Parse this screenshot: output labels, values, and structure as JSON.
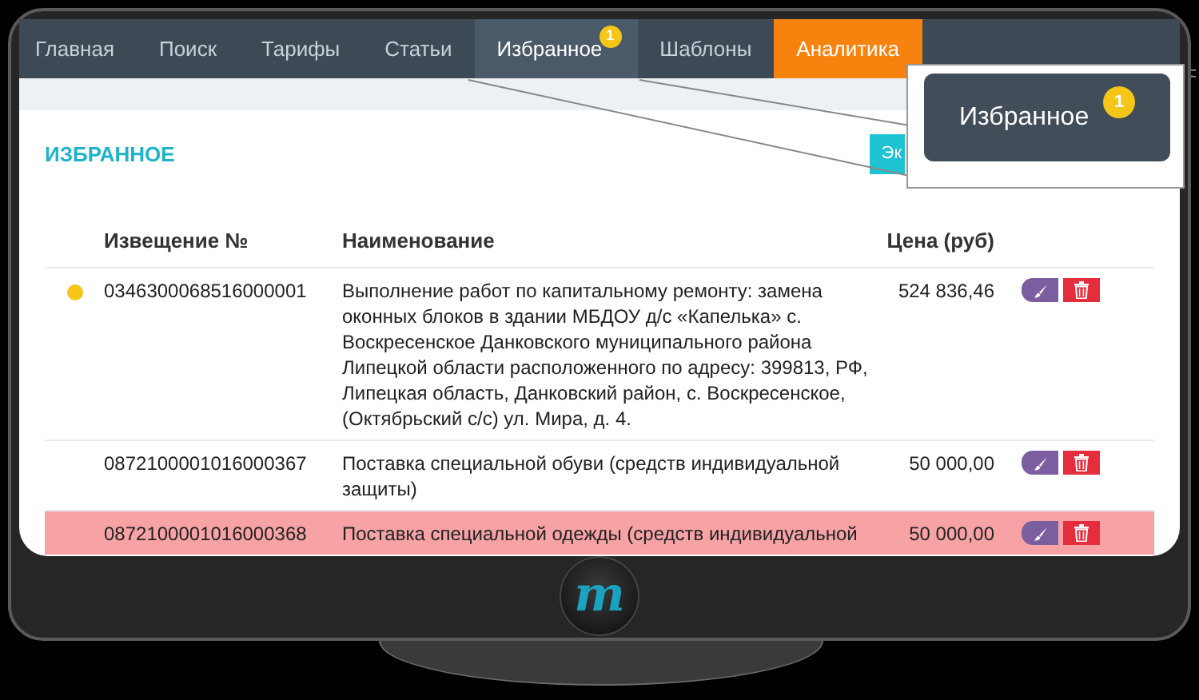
{
  "nav": {
    "tabs": [
      {
        "label": "Главная",
        "selected": false,
        "kind": "plain"
      },
      {
        "label": "Поиск",
        "selected": false,
        "kind": "plain"
      },
      {
        "label": "Тарифы",
        "selected": false,
        "kind": "plain"
      },
      {
        "label": "Статьи",
        "selected": false,
        "kind": "plain"
      },
      {
        "label": "Избранное",
        "selected": true,
        "kind": "plain",
        "badge": "1"
      },
      {
        "label": "Шаблоны",
        "selected": false,
        "kind": "plain"
      },
      {
        "label": "Аналитика",
        "selected": false,
        "kind": "highlight"
      }
    ]
  },
  "page": {
    "title": "ИЗБРАННОЕ",
    "button": "Эк"
  },
  "table": {
    "columns": [
      "Извещение №",
      "Наименование",
      "Цена (руб)"
    ],
    "rows": [
      {
        "number": "0346300068516000001",
        "name": "Выполнение работ по капитальному ремонту: замена оконных блоков в здании МБДОУ д/с «Капелька» с. Воскресенское Данковского муниципального района Липецкой области расположенного по адресу: 399813, РФ, Липецкая область, Данковский район, с. Воскресенское, (Октябрьский с/с) ул. Мира, д. 4.",
        "price": "524 836,46",
        "marked": true,
        "highlighted": false
      },
      {
        "number": "0872100001016000367",
        "name": "Поставка специальной обуви (средств индивидуальной защиты)",
        "price": "50 000,00",
        "marked": false,
        "highlighted": false
      },
      {
        "number": "0872100001016000368",
        "name": "Поставка специальной одежды (средств индивидуальной",
        "price": "50 000,00",
        "marked": false,
        "highlighted": true
      }
    ]
  },
  "callout": {
    "label": "Избранное",
    "badge": "1"
  },
  "logo": "m"
}
